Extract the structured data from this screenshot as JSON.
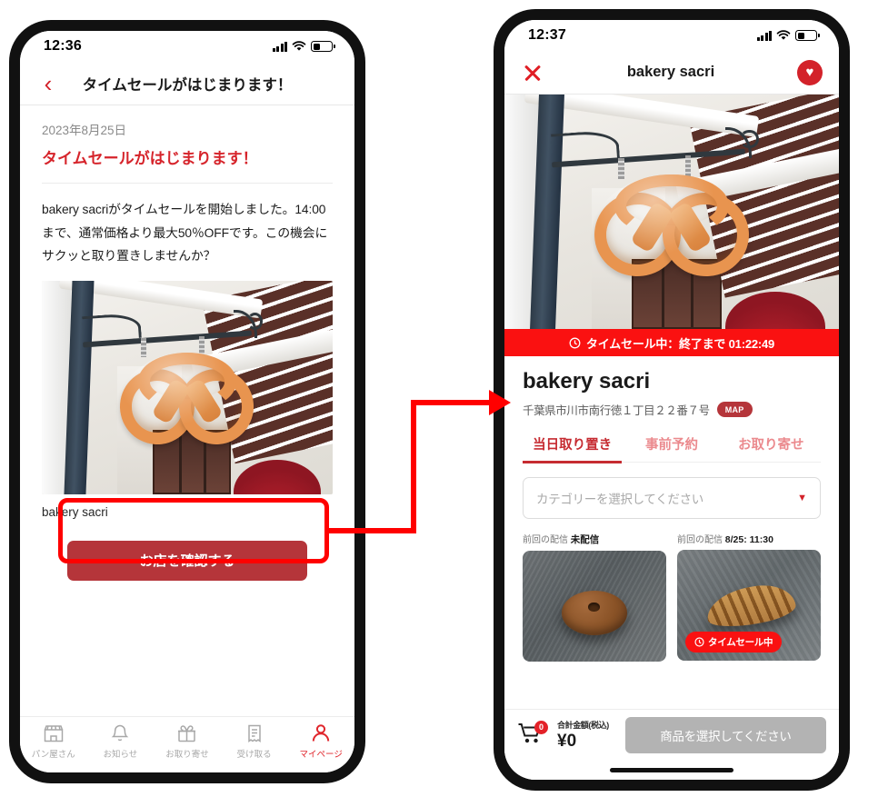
{
  "left_phone": {
    "status": {
      "time": "12:36",
      "signal_icon": "signal-bars-icon",
      "wifi_icon": "wifi-icon",
      "battery_icon": "battery-icon"
    },
    "header": {
      "back_icon": "chevron-left-icon",
      "title": "タイムセールがはじまります！"
    },
    "notice": {
      "date": "2023年8月25日",
      "title": "タイムセールがはじまります！",
      "body": "bakery sacriがタイムセールを開始しました。14:00まで、通常価格より最大50％OFFです。この機会にサクッと取り置きしませんか？",
      "photo_alt": "pretzel-shop-sign-photo",
      "shop_name": "bakery sacri",
      "cta_label": "お店を確認する"
    },
    "tabbar": {
      "items": [
        {
          "label": "パン屋さん",
          "icon": "storefront-icon",
          "active": false
        },
        {
          "label": "お知らせ",
          "icon": "bell-icon",
          "active": false
        },
        {
          "label": "お取り寄せ",
          "icon": "gift-icon",
          "active": false
        },
        {
          "label": "受け取る",
          "icon": "receipt-icon",
          "active": false
        },
        {
          "label": "マイページ",
          "icon": "person-icon",
          "active": true
        }
      ]
    }
  },
  "right_phone": {
    "status": {
      "time": "12:37",
      "signal_icon": "signal-bars-icon",
      "wifi_icon": "wifi-icon",
      "battery_icon": "battery-icon"
    },
    "header": {
      "close_icon": "close-x-icon",
      "title": "bakery sacri",
      "favorite_icon": "heart-icon",
      "favorite_glyph": "♥"
    },
    "hero": {
      "photo_alt": "pretzel-shop-sign-photo"
    },
    "sale_banner": {
      "clock_glyph": "🕐",
      "text": "タイムセール中：終了まで 01:22:49"
    },
    "shop": {
      "name": "bakery sacri",
      "address": "千葉県市川市南行徳１丁目２２番７号",
      "map_badge": "MAP"
    },
    "tabs": [
      {
        "label": "当日取り置き",
        "active": true
      },
      {
        "label": "事前予約",
        "active": false
      },
      {
        "label": "お取り寄せ",
        "active": false
      }
    ],
    "category_select": {
      "placeholder": "カテゴリーを選択してください",
      "caret_glyph": "▼"
    },
    "products": [
      {
        "meta_label": "前回の配信",
        "meta_value": "未配信",
        "photo_alt": "donut-photo",
        "sale_badge": null
      },
      {
        "meta_label": "前回の配信",
        "meta_value": "8/25: 11:30",
        "photo_alt": "croissant-photo",
        "sale_badge": "タイムセール中"
      }
    ],
    "cart": {
      "count": "0",
      "total_label": "合計金額(税込)",
      "total_amount": "¥0",
      "cta_label": "商品を選択してください"
    }
  },
  "annotations": {
    "highlight_color": "#ff0000",
    "arrow_name": "flow-arrow-button-to-shop-page"
  },
  "colors": {
    "brand_red": "#d3222a",
    "sale_red": "#fa1111",
    "button_red": "#b5353a",
    "muted_gray": "#b3b3b3"
  }
}
